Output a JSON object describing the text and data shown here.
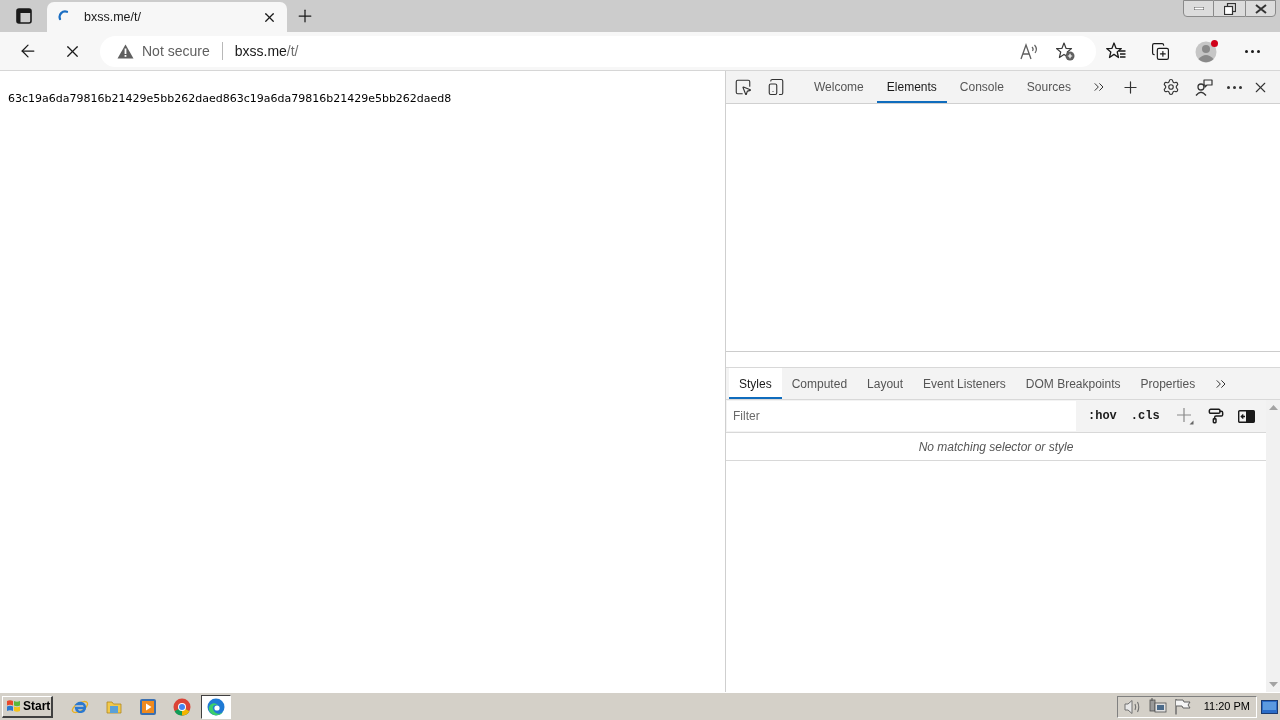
{
  "browser": {
    "tab": {
      "title": "bxss.me/t/",
      "loading": true,
      "selected": true
    },
    "address_bar": {
      "security_label": "Not secure",
      "host": "bxss.me",
      "path": "/t/"
    },
    "profile": {
      "notification": true
    }
  },
  "page": {
    "text": "63c19a6da79816b21429e5bb262daed863c19a6da79816b21429e5bb262daed8"
  },
  "devtools": {
    "tabs": [
      {
        "label": "Welcome",
        "selected": false
      },
      {
        "label": "Elements",
        "selected": true
      },
      {
        "label": "Console",
        "selected": false
      },
      {
        "label": "Sources",
        "selected": false
      }
    ],
    "styles_tabs": [
      {
        "label": "Styles",
        "selected": true
      },
      {
        "label": "Computed",
        "selected": false
      },
      {
        "label": "Layout",
        "selected": false
      },
      {
        "label": "Event Listeners",
        "selected": false
      },
      {
        "label": "DOM Breakpoints",
        "selected": false
      },
      {
        "label": "Properties",
        "selected": false
      }
    ],
    "filter": {
      "placeholder": "Filter"
    },
    "toggles": [
      ":hov",
      ".cls"
    ],
    "message": "No matching selector or style"
  },
  "taskbar": {
    "start_label": "Start",
    "apps": [
      {
        "kind": "ie",
        "selected": false
      },
      {
        "kind": "explorer",
        "selected": false
      },
      {
        "kind": "media",
        "selected": false
      },
      {
        "kind": "chrome",
        "selected": false
      },
      {
        "kind": "edge",
        "selected": true
      }
    ],
    "clock": "11:20 PM"
  }
}
